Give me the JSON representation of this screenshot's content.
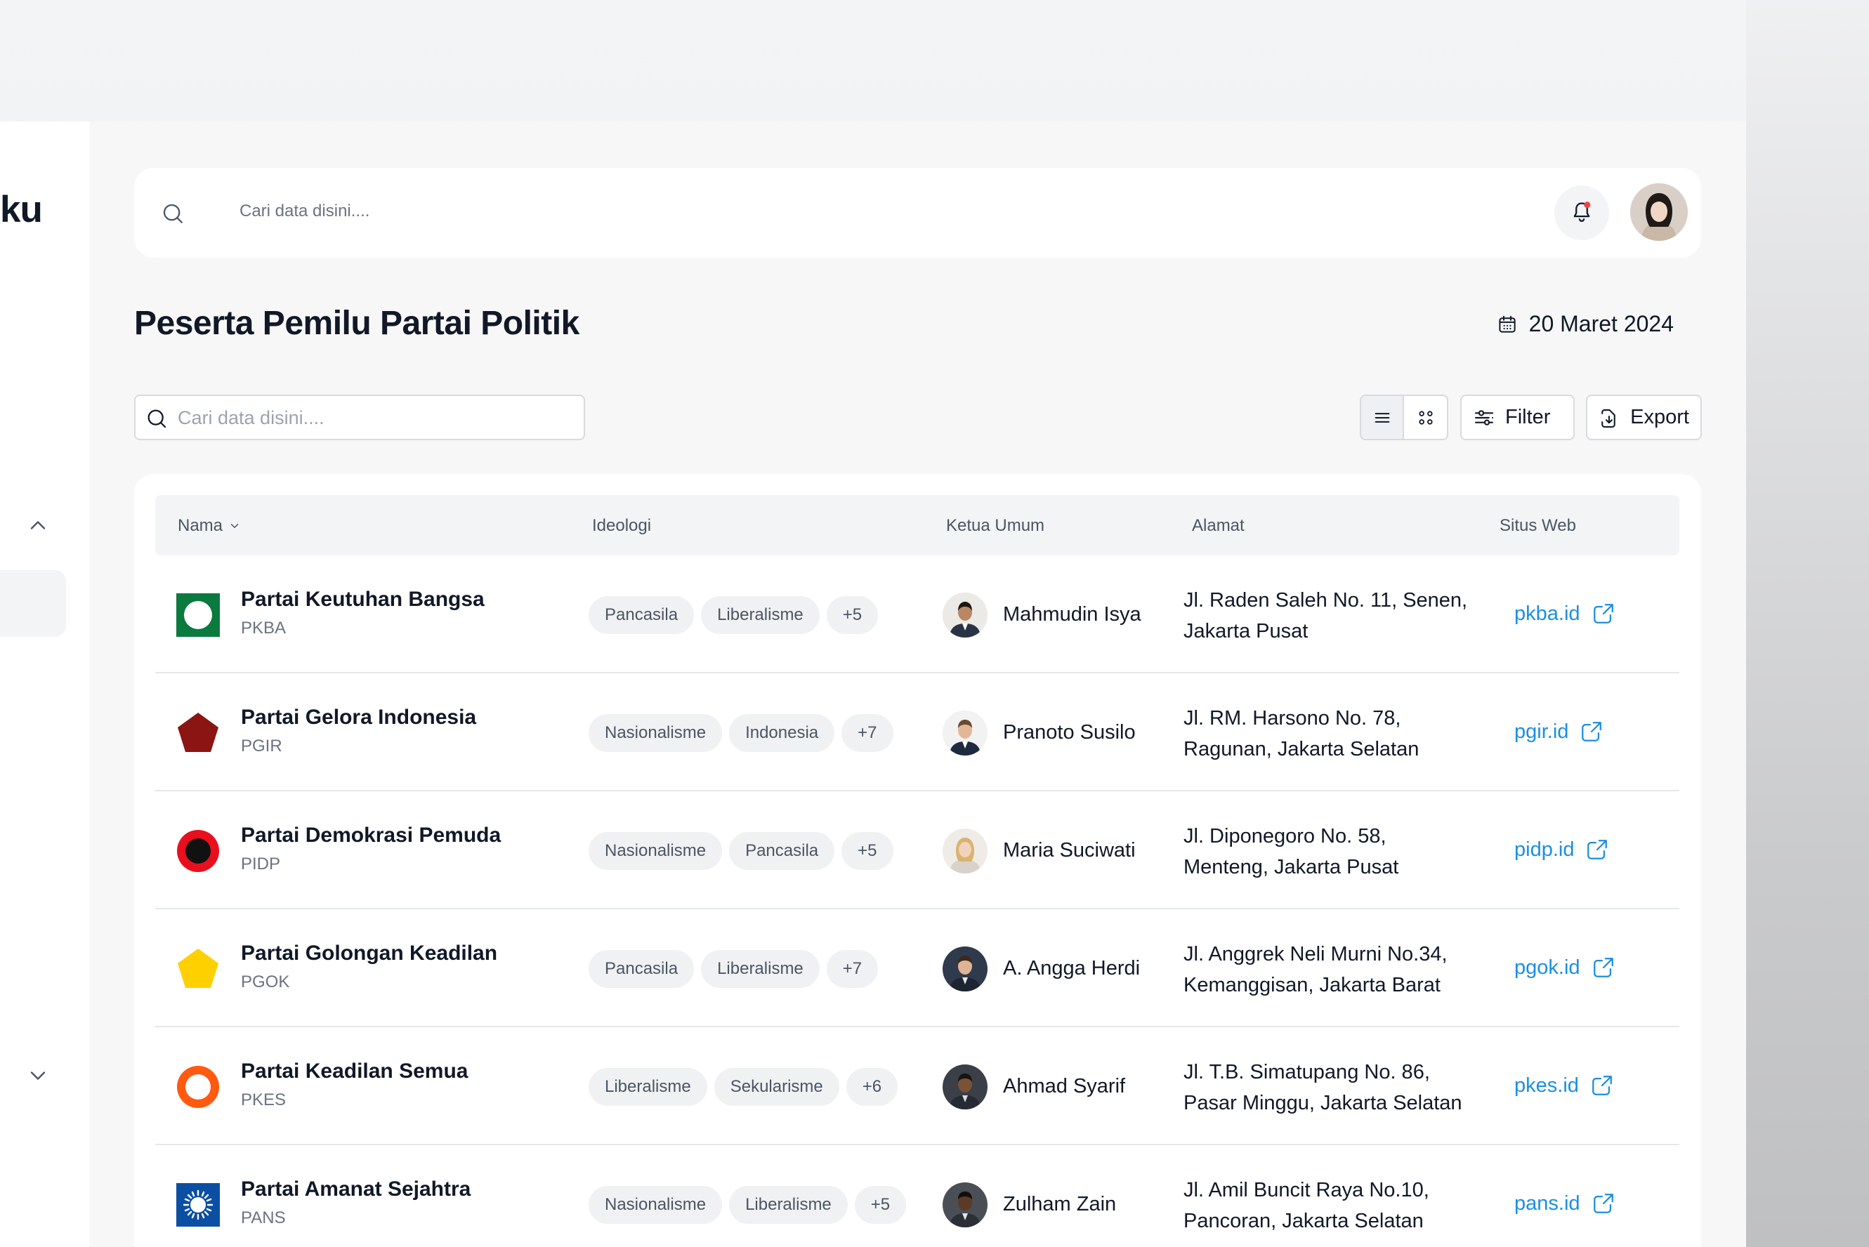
{
  "brand": {
    "text": "ku"
  },
  "topbar": {
    "search_placeholder": "Cari data disini....",
    "notification_dot_color": "#ef4444"
  },
  "page": {
    "title": "Peserta Pemilu Partai Politik",
    "date": "20 Maret 2024"
  },
  "toolbar": {
    "search_placeholder": "Cari data disini....",
    "filter_label": "Filter",
    "export_label": "Export",
    "view_mode": "list"
  },
  "table": {
    "headers": {
      "nama": "Nama",
      "ideologi": "Ideologi",
      "ketua": "Ketua Umum",
      "alamat": "Alamat",
      "web": "Situs Web"
    },
    "rows": [
      {
        "name": "Partai Keutuhan Bangsa",
        "abbr": "PKBA",
        "logo": "green-square-white-circle",
        "tags": [
          "Pancasila",
          "Liberalisme",
          "+5"
        ],
        "leader": "Mahmudin Isya",
        "address": [
          "Jl. Raden Saleh No. 11, Senen,",
          "Jakarta Pusat"
        ],
        "website": "pkba.id"
      },
      {
        "name": "Partai Gelora Indonesia",
        "abbr": "PGIR",
        "logo": "dark-red-pentagon",
        "tags": [
          "Nasionalisme",
          "Indonesia",
          "+7"
        ],
        "leader": "Pranoto Susilo",
        "address": [
          "Jl. RM. Harsono No. 78,",
          "Ragunan, Jakarta Selatan"
        ],
        "website": "pgir.id"
      },
      {
        "name": "Partai Demokrasi Pemuda",
        "abbr": "PIDP",
        "logo": "red-circle-black-center",
        "tags": [
          "Nasionalisme",
          "Pancasila",
          "+5"
        ],
        "leader": "Maria Suciwati",
        "address": [
          "Jl. Diponegoro No. 58,",
          "Menteng, Jakarta Pusat"
        ],
        "website": "pidp.id"
      },
      {
        "name": "Partai Golongan Keadilan",
        "abbr": "PGOK",
        "logo": "yellow-pentagon",
        "tags": [
          "Pancasila",
          "Liberalisme",
          "+7"
        ],
        "leader": "A. Angga Herdi",
        "address": [
          "Jl. Anggrek Neli Murni No.34,",
          "Kemanggisan, Jakarta Barat"
        ],
        "website": "pgok.id"
      },
      {
        "name": "Partai Keadilan Semua",
        "abbr": "PKES",
        "logo": "orange-ring",
        "tags": [
          "Liberalisme",
          "Sekularisme",
          "+6"
        ],
        "leader": "Ahmad Syarif",
        "address": [
          "Jl. T.B. Simatupang No. 86,",
          "Pasar Minggu, Jakarta Selatan"
        ],
        "website": "pkes.id"
      },
      {
        "name": "Partai Amanat Sejahtra",
        "abbr": "PANS",
        "logo": "blue-square-white-sun",
        "tags": [
          "Nasionalisme",
          "Liberalisme",
          "+5"
        ],
        "leader": "Zulham Zain",
        "address": [
          "Jl. Amil Buncit Raya No.10,",
          "Pancoran, Jakarta Selatan"
        ],
        "website": "pans.id"
      }
    ]
  },
  "colors": {
    "link": "#1a8fe0",
    "logo_green": "#0a7a3e",
    "logo_darkred": "#8b1512",
    "logo_red": "#e8101c",
    "logo_yellow": "#ffd000",
    "logo_orange": "#ff5a10",
    "logo_blue": "#0b4fa3"
  }
}
